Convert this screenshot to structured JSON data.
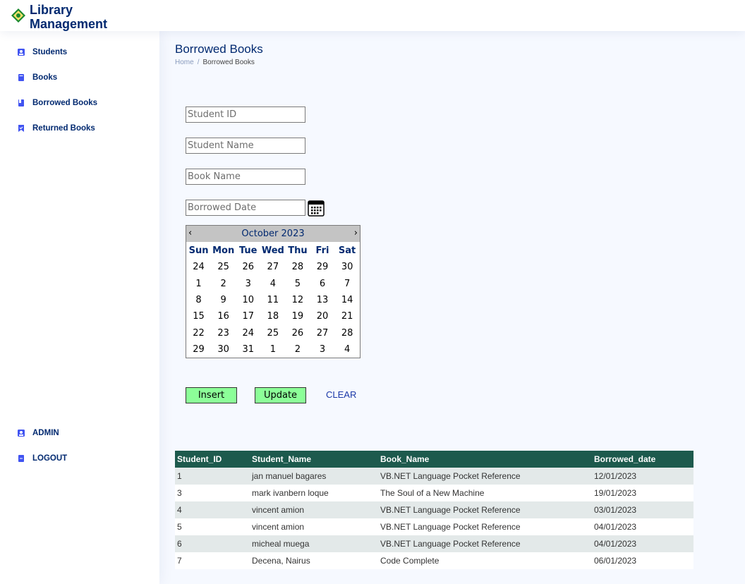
{
  "header": {
    "title_line1": "Library",
    "title_line2": "Management"
  },
  "sidebar": {
    "items": [
      {
        "label": "Students",
        "icon": "students-icon"
      },
      {
        "label": "Books",
        "icon": "book-icon"
      },
      {
        "label": "Borrowed Books",
        "icon": "borrowed-book-icon"
      },
      {
        "label": "Returned Books",
        "icon": "returned-book-icon"
      }
    ],
    "admin": "ADMIN",
    "logout": "LOGOUT"
  },
  "page": {
    "title": "Borrowed Books"
  },
  "breadcrumb": {
    "home": "Home",
    "sep": "/",
    "current": "Borrowed Books"
  },
  "form": {
    "student_id_placeholder": "Student ID",
    "student_name_placeholder": "Student Name",
    "book_name_placeholder": "Book Name",
    "borrowed_date_placeholder": "Borrowed Date"
  },
  "calendar": {
    "month_label": "October 2023",
    "prev": "‹",
    "next": "›",
    "days_of_week": [
      "Sun",
      "Mon",
      "Tue",
      "Wed",
      "Thu",
      "Fri",
      "Sat"
    ],
    "weeks": [
      [
        "24",
        "25",
        "26",
        "27",
        "28",
        "29",
        "30"
      ],
      [
        "1",
        "2",
        "3",
        "4",
        "5",
        "6",
        "7"
      ],
      [
        "8",
        "9",
        "10",
        "11",
        "12",
        "13",
        "14"
      ],
      [
        "15",
        "16",
        "17",
        "18",
        "19",
        "20",
        "21"
      ],
      [
        "22",
        "23",
        "24",
        "25",
        "26",
        "27",
        "28"
      ],
      [
        "29",
        "30",
        "31",
        "1",
        "2",
        "3",
        "4"
      ]
    ]
  },
  "buttons": {
    "insert": "Insert",
    "update": "Update",
    "clear": "CLEAR"
  },
  "table": {
    "columns": [
      "Student_ID",
      "Student_Name",
      "Book_Name",
      "Borrowed_date"
    ],
    "rows": [
      [
        "1",
        "jan manuel bagares",
        "VB.NET Language Pocket Reference",
        "12/01/2023"
      ],
      [
        "3",
        "mark ivanbern loque",
        "The Soul of a New Machine",
        "19/01/2023"
      ],
      [
        "4",
        "vincent amion",
        "VB.NET Language Pocket Reference",
        "03/01/2023"
      ],
      [
        "5",
        "vincent amion",
        "VB.NET Language Pocket Reference",
        "04/01/2023"
      ],
      [
        "6",
        "micheal muega",
        "VB.NET Language Pocket Reference",
        "04/01/2023"
      ],
      [
        "7",
        "Decena, Nairus",
        "Code Complete",
        "06/01/2023"
      ]
    ]
  },
  "colors": {
    "header_row": "#1d5a4d",
    "accent": "#012970",
    "button": "#8cff98"
  }
}
